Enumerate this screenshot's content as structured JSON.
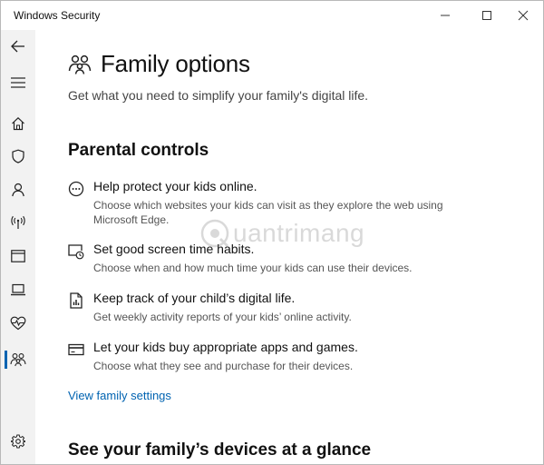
{
  "window": {
    "title": "Windows Security"
  },
  "sidebar": {
    "items": [
      {
        "name": "back",
        "icon": "back-arrow-icon"
      },
      {
        "name": "menu",
        "icon": "hamburger-menu-icon"
      },
      {
        "name": "home",
        "icon": "home-icon"
      },
      {
        "name": "virus-protection",
        "icon": "shield-icon"
      },
      {
        "name": "account-protection",
        "icon": "person-icon"
      },
      {
        "name": "firewall-network",
        "icon": "wireless-antenna-icon"
      },
      {
        "name": "app-browser-control",
        "icon": "browser-window-icon"
      },
      {
        "name": "device-security",
        "icon": "laptop-icon"
      },
      {
        "name": "device-performance",
        "icon": "heart-pulse-icon"
      },
      {
        "name": "family-options",
        "icon": "family-icon",
        "active": true
      },
      {
        "name": "settings",
        "icon": "gear-icon"
      }
    ]
  },
  "page": {
    "title": "Family options",
    "subtitle": "Get what you need to simplify your family's digital life.",
    "sections": {
      "parental": "Parental controls",
      "devices": "See your family’s devices at a glance"
    },
    "features": [
      {
        "icon": "chat-bubble-icon",
        "title": "Help protect your kids online.",
        "description": "Choose which websites your kids can visit as they explore the web using Microsoft Edge."
      },
      {
        "icon": "screen-clock-icon",
        "title": "Set good screen time habits.",
        "description": "Choose when and how much time your kids can use their devices."
      },
      {
        "icon": "activity-report-icon",
        "title": "Keep track of your child’s digital life.",
        "description": "Get weekly activity reports of your kids’ online activity."
      },
      {
        "icon": "credit-card-icon",
        "title": "Let your kids buy appropriate apps and games.",
        "description": "Choose what they see and purchase for their devices."
      }
    ],
    "link": "View family settings"
  },
  "watermark": {
    "text": "uantrimang"
  },
  "colors": {
    "accent": "#0063b1",
    "sidebar_bg": "#f2f2f2"
  }
}
